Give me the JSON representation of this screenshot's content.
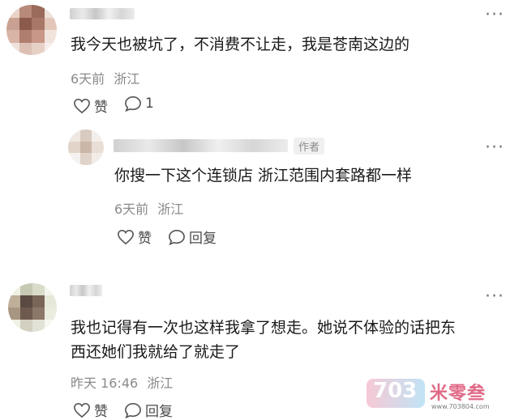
{
  "comment1": {
    "text": "我今天也被坑了，不消费不让走，我是苍南这边的",
    "time": "6天前",
    "location": "浙江",
    "like_label": "赞",
    "reply_count": "1",
    "more": "···"
  },
  "reply1": {
    "author_tag": "作者",
    "text": "你搜一下这个连锁店 浙江范围内套路都一样",
    "time": "6天前",
    "location": "浙江",
    "like_label": "赞",
    "reply_label": "回复",
    "more": "···"
  },
  "comment2": {
    "text_line1": "我也记得有一次也这样我拿了想走。她说不体验的话把东",
    "text_line2": "西还她们我就给了就走了",
    "time": "昨天 16:46",
    "location": "浙江",
    "like_label": "赞",
    "reply_label": "回复",
    "more": "···"
  },
  "watermark": {
    "logo": "703",
    "name": "米零叁",
    "url": "www.703804.com"
  },
  "colors": {
    "text": "#1a1a1a",
    "meta": "#8a8a8a",
    "watermark_pink": "#e06a86",
    "watermark_blue": "#4db3e8"
  }
}
